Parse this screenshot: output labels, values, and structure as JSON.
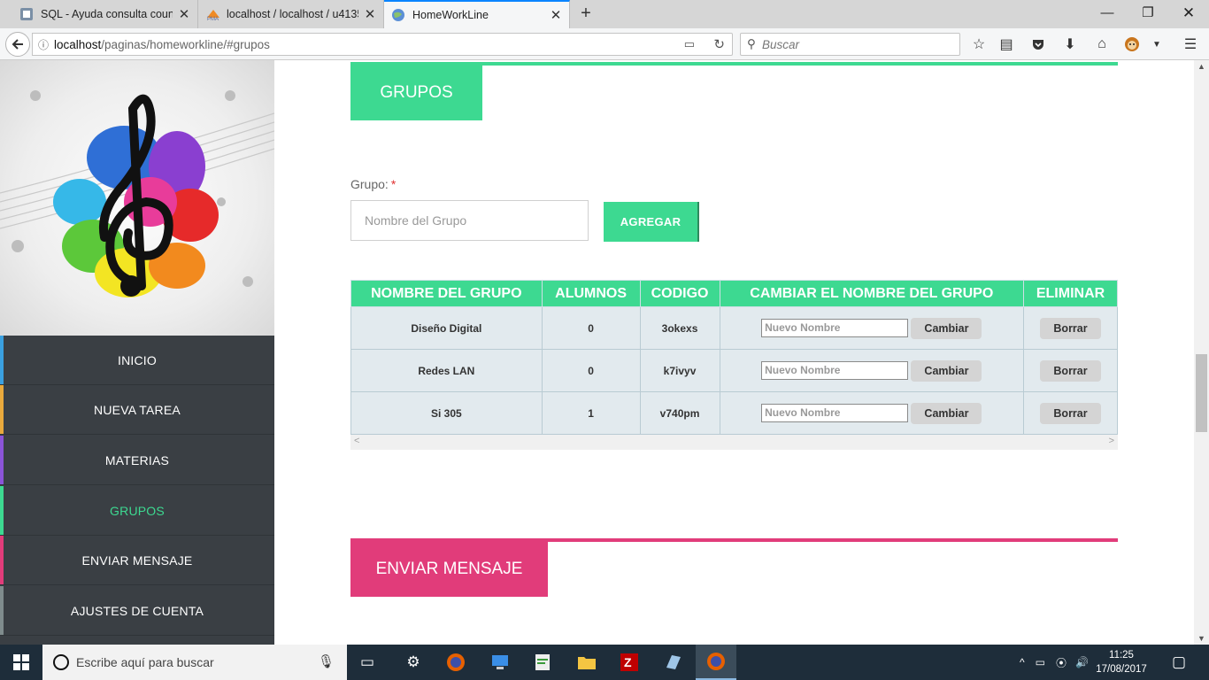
{
  "browser": {
    "tabs": [
      {
        "label": "SQL - Ayuda consulta count",
        "icon": "sql-favicon",
        "active": false
      },
      {
        "label": "localhost / localhost / u4135",
        "icon": "phpmyadmin-favicon",
        "active": false
      },
      {
        "label": "HomeWorkLine",
        "icon": "globe-favicon",
        "active": true
      }
    ],
    "url_host": "localhost",
    "url_path": "/paginas/homeworkline/#grupos",
    "search_placeholder": "Buscar"
  },
  "sidebar": {
    "items": [
      {
        "label": "INICIO",
        "accent": "#3aa0e0"
      },
      {
        "label": "NUEVA TAREA",
        "accent": "#e8a93c"
      },
      {
        "label": "MATERIAS",
        "accent": "#8b54d8"
      },
      {
        "label": "GRUPOS",
        "accent": "#3dd991",
        "active": true
      },
      {
        "label": "ENVIAR MENSAJE",
        "accent": "#e13c7a"
      },
      {
        "label": "AJUSTES DE CUENTA",
        "accent": "#7f8c8d"
      }
    ]
  },
  "main": {
    "groups_section": {
      "title": "GRUPOS",
      "color": "#3dd991",
      "form": {
        "label": "Grupo:",
        "required_mark": "*",
        "placeholder": "Nombre del Grupo",
        "add_label": "AGREGAR"
      },
      "table": {
        "headers": [
          "NOMBRE DEL GRUPO",
          "ALUMNOS",
          "CODIGO",
          "CAMBIAR EL NOMBRE DEL GRUPO",
          "ELIMINAR"
        ],
        "rows": [
          {
            "name": "Diseño Digital",
            "students": "0",
            "code": "3okexs",
            "rename_placeholder": "Nuevo Nombre",
            "rename_label": "Cambiar",
            "delete_label": "Borrar"
          },
          {
            "name": "Redes LAN",
            "students": "0",
            "code": "k7ivyv",
            "rename_placeholder": "Nuevo Nombre",
            "rename_label": "Cambiar",
            "delete_label": "Borrar"
          },
          {
            "name": "Si 305",
            "students": "1",
            "code": "v740pm",
            "rename_placeholder": "Nuevo Nombre",
            "rename_label": "Cambiar",
            "delete_label": "Borrar"
          }
        ]
      }
    },
    "message_section": {
      "title": "ENVIAR MENSAJE",
      "color": "#e13c7a"
    }
  },
  "taskbar": {
    "search_placeholder": "Escribe aquí para buscar",
    "time": "11:25",
    "date": "17/08/2017"
  }
}
